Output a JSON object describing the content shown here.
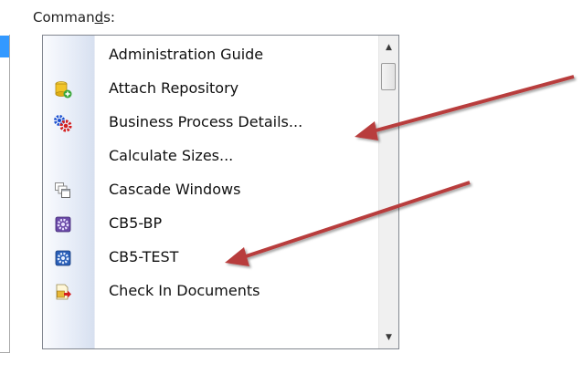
{
  "commands_label": {
    "before": "Comman",
    "underlined": "d",
    "after": "s:"
  },
  "commands": [
    {
      "label": "Administration Guide",
      "icon": "none"
    },
    {
      "label": "Attach Repository",
      "icon": "attach-repository-icon"
    },
    {
      "label": "Business Process Details...",
      "icon": "gears-icon"
    },
    {
      "label": "Calculate Sizes...",
      "icon": "none"
    },
    {
      "label": "Cascade Windows",
      "icon": "cascade-windows-icon"
    },
    {
      "label": "CB5-BP",
      "icon": "purple-gear-icon"
    },
    {
      "label": "CB5-TEST",
      "icon": "blue-gear-icon"
    },
    {
      "label": "Check In Documents",
      "icon": "check-in-documents-icon"
    }
  ],
  "scrollbar": {
    "up": "▲",
    "down": "▼"
  },
  "colors": {
    "selection": "#3399ff",
    "arrow": "#b83c3c"
  }
}
